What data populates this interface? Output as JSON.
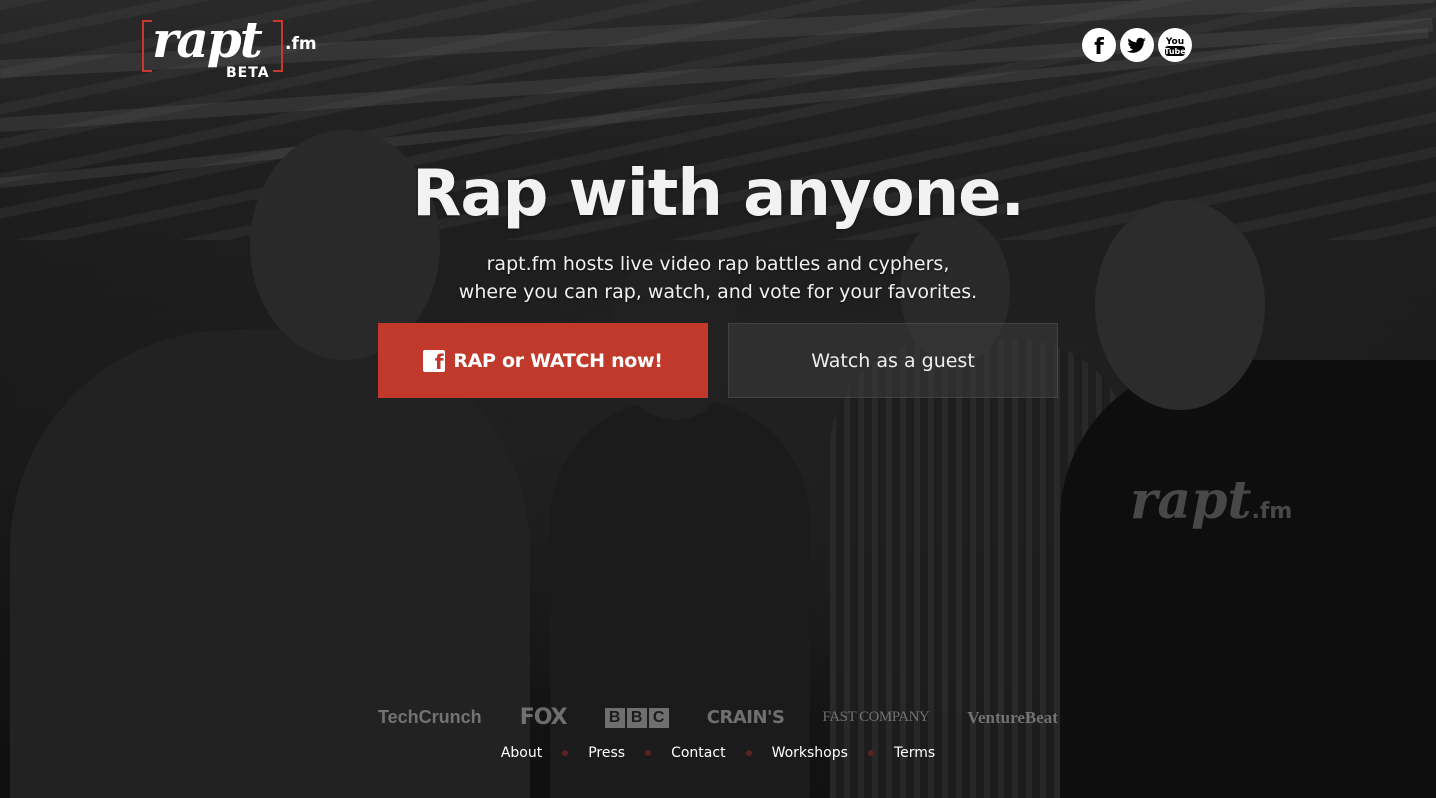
{
  "header": {
    "logo_word": "rapt",
    "logo_badge": "BETA",
    "logo_suffix": ".fm",
    "social": [
      {
        "name": "facebook-icon",
        "glyph": "f"
      },
      {
        "name": "twitter-icon",
        "glyph": "bird"
      },
      {
        "name": "youtube-icon",
        "glyph": "You Tube"
      }
    ]
  },
  "hero": {
    "headline": "Rap with anyone.",
    "subline_1": "rapt.fm hosts live video rap battles and cyphers,",
    "subline_2": "where you can rap, watch, and vote for your favorites."
  },
  "cta": {
    "primary_icon": "f",
    "primary_label": "RAP or WATCH now!",
    "secondary_label": "Watch as a guest"
  },
  "press": {
    "techcrunch": "TechCrunch",
    "fox": "FOX",
    "bbc": [
      "B",
      "B",
      "C"
    ],
    "crains": "CRAIN'S",
    "fastcompany": "FAST COMPANY",
    "venturebeat": "VentureBeat"
  },
  "footer": {
    "links": [
      "About",
      "Press",
      "Contact",
      "Workshops",
      "Terms"
    ]
  },
  "background_scene": {
    "shirt_logo": "rapt",
    "shirt_logo_suffix": ".fm"
  },
  "colors": {
    "accent": "#c0392b",
    "logo_bracket": "#c9382a",
    "footer_dot": "#5a2320"
  }
}
